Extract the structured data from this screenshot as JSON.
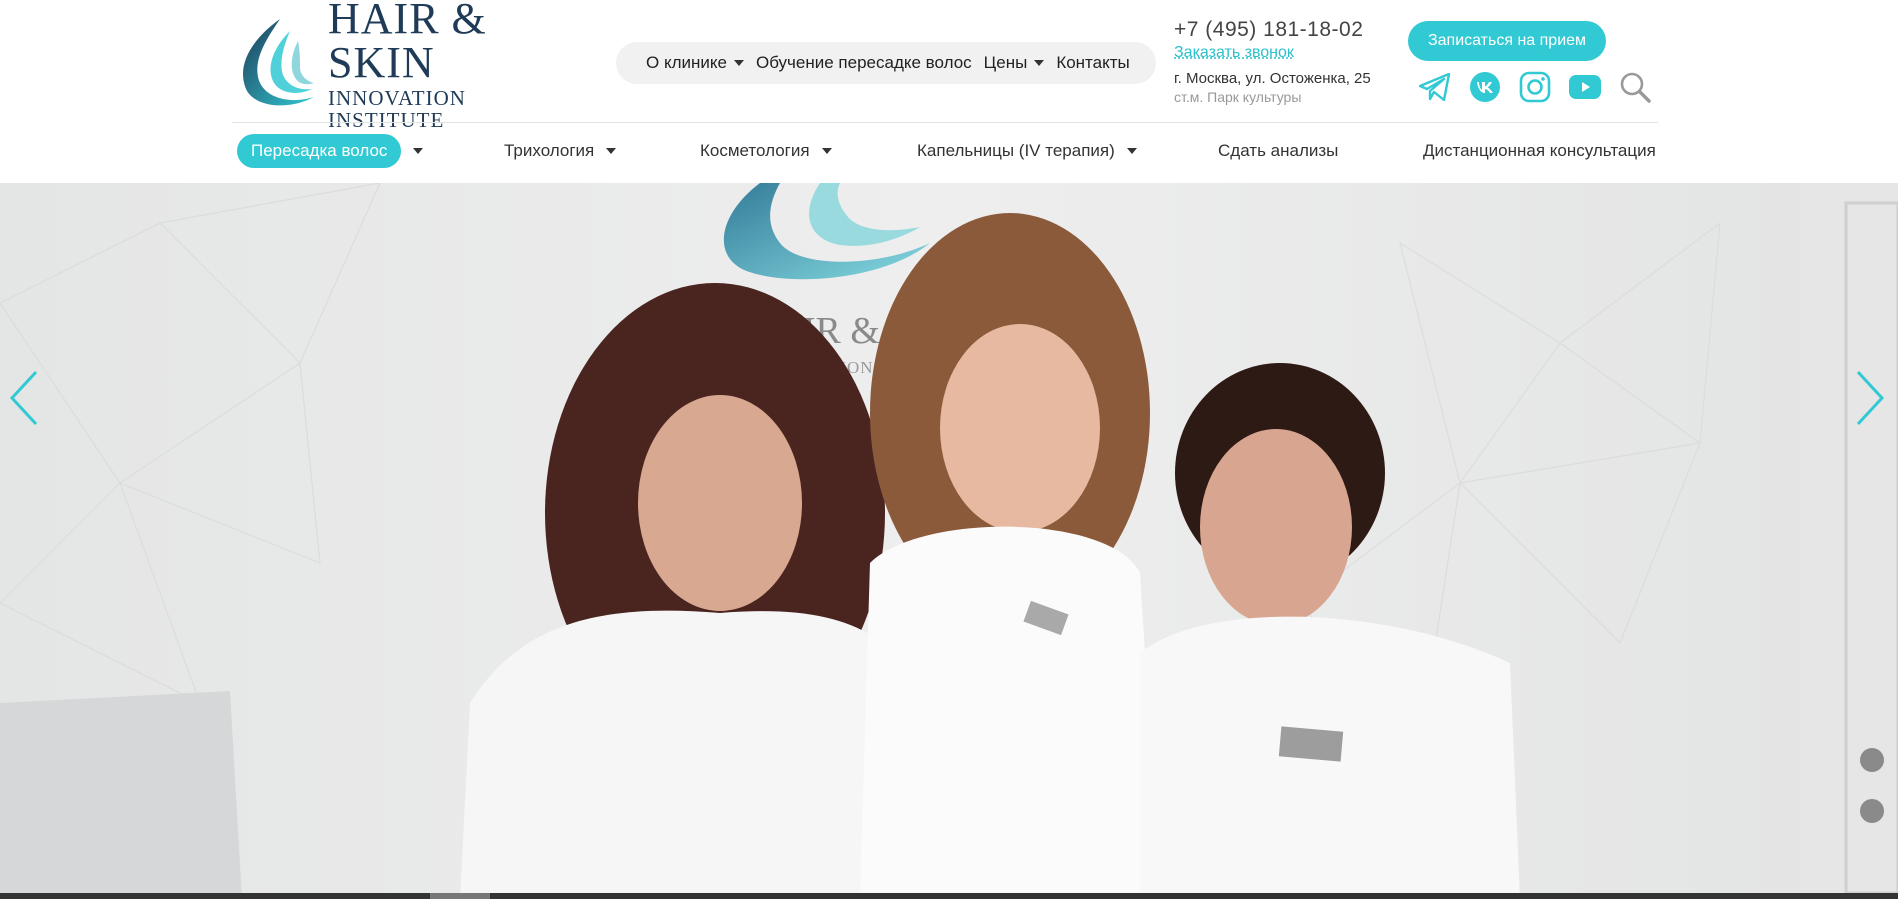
{
  "brand": {
    "title": "HAIR & SKIN",
    "subtitle": "INNOVATION INSTITUTE",
    "accent_color": "#31c9d3",
    "dark_color": "#1f3b57"
  },
  "top_nav": [
    {
      "label": "О клинике",
      "has_dropdown": true
    },
    {
      "label": "Обучение пересадке волос",
      "has_dropdown": false
    },
    {
      "label": "Цены",
      "has_dropdown": true
    },
    {
      "label": "Контакты",
      "has_dropdown": false
    }
  ],
  "contacts": {
    "phone": "+7 (495) 181-18-02",
    "callback_label": "Заказать звонок",
    "address": "г. Москва, ул. Остоженка, 25",
    "metro": "ст.м. Парк культуры"
  },
  "book_button": "Записаться на прием",
  "social_icons": [
    "telegram-icon",
    "vk-icon",
    "instagram-icon",
    "youtube-icon",
    "search-icon"
  ],
  "main_nav": [
    {
      "label": "Пересадка волос",
      "has_dropdown": true,
      "active": true
    },
    {
      "label": "Трихология",
      "has_dropdown": true,
      "active": false
    },
    {
      "label": "Косметология",
      "has_dropdown": true,
      "active": false
    },
    {
      "label": "Капельницы (IV терапия)",
      "has_dropdown": true,
      "active": false
    },
    {
      "label": "Сдать анализы",
      "has_dropdown": false,
      "active": false
    },
    {
      "label": "Дистанционная консультация",
      "has_dropdown": false,
      "active": false
    }
  ],
  "hero": {
    "image": "clinic-team-photo",
    "wall_logo_text": "HAIR & SKIN",
    "wall_logo_sub": "INNOVATION INSTITUTE",
    "prev_icon": "chevron-left-icon",
    "next_icon": "chevron-right-icon"
  }
}
